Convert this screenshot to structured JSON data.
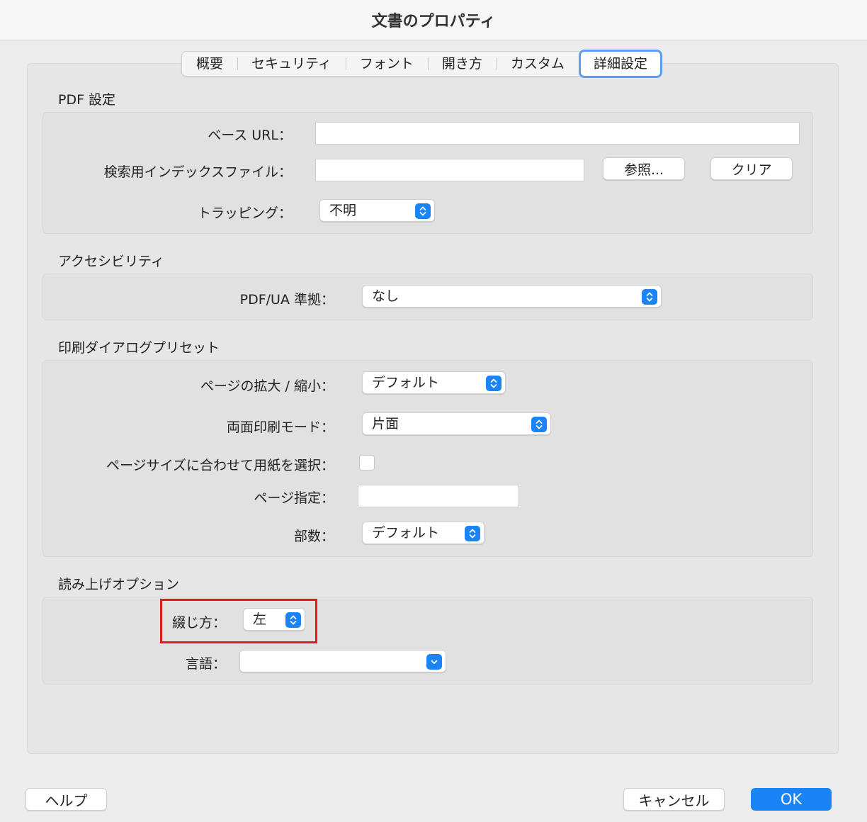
{
  "window": {
    "title": "文書のプロパティ"
  },
  "tabs": [
    "概要",
    "セキュリティ",
    "フォント",
    "開き方",
    "カスタム",
    "詳細設定"
  ],
  "selected_tab": "詳細設定",
  "pdf_settings": {
    "title": "PDF 設定",
    "base_url_label": "ベース URL：",
    "base_url_value": "",
    "search_index_label": "検索用インデックスファイル：",
    "search_index_value": "",
    "browse_button": "参照...",
    "clear_button": "クリア",
    "trapping_label": "トラッピング：",
    "trapping_value": "不明"
  },
  "accessibility": {
    "title": "アクセシビリティ",
    "pdfua_label": "PDF/UA 準拠：",
    "pdfua_value": "なし"
  },
  "print_presets": {
    "title": "印刷ダイアログプリセット",
    "scaling_label": "ページの拡大 / 縮小：",
    "scaling_value": "デフォルト",
    "duplex_label": "両面印刷モード：",
    "duplex_value": "片面",
    "paper_by_size_label": "ページサイズに合わせて用紙を選択：",
    "paper_by_size_checked": false,
    "page_range_label": "ページ指定：",
    "page_range_value": "",
    "copies_label": "部数：",
    "copies_value": "デフォルト"
  },
  "reading_options": {
    "title": "読み上げオプション",
    "binding_label": "綴じ方：",
    "binding_value": "左",
    "language_label": "言語：",
    "language_value": ""
  },
  "footer": {
    "help_button": "ヘルプ",
    "cancel_button": "キャンセル",
    "ok_button": "OK"
  },
  "colors": {
    "accent": "#1a83f5",
    "highlight": "#e01b1b",
    "tab_focus": "#5b9ef2"
  },
  "icons": {
    "popup_stepper": "up-down-chevron-icon",
    "popup_dropdown": "chevron-down-icon"
  }
}
